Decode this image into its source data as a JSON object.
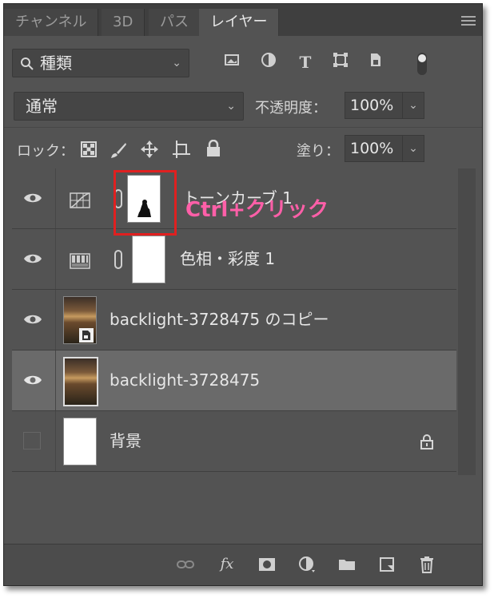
{
  "tabs": [
    {
      "label": "チャンネル",
      "active": false
    },
    {
      "label": "3D",
      "active": false
    },
    {
      "label": "パス",
      "active": false
    },
    {
      "label": "レイヤー",
      "active": true
    }
  ],
  "filter": {
    "kind_label": "種類"
  },
  "blend": {
    "mode": "通常",
    "opacity_label": "不透明度：",
    "opacity_value": "100%"
  },
  "lock": {
    "label": "ロック：",
    "fill_label": "塗り：",
    "fill_value": "100%"
  },
  "layers": [
    {
      "name": "トーンカーブ 1",
      "type": "curves-adjustment",
      "visible": true,
      "selected": false
    },
    {
      "name": "色相・彩度 1",
      "type": "hue-saturation-adjustment",
      "visible": true,
      "selected": false
    },
    {
      "name": "backlight-3728475 のコピー",
      "type": "smart-object",
      "visible": true,
      "selected": false
    },
    {
      "name": "backlight-3728475",
      "type": "image",
      "visible": true,
      "selected": true
    },
    {
      "name": "背景",
      "type": "background",
      "visible": false,
      "selected": false,
      "locked": true
    }
  ],
  "annotation": {
    "text": "Ctrl+クリック",
    "color": "#ff5fa8",
    "box_color": "#e02020"
  },
  "colors": {
    "panel": "#535353",
    "selected_row": "#6a6a6a",
    "tabbar": "#3f3f3f"
  },
  "icons": [
    "image-filter-icon",
    "adjustment-filter-icon",
    "type-filter-icon",
    "shape-filter-icon",
    "smart-object-filter-icon",
    "filter-toggle-icon",
    "lock-transparent-icon",
    "lock-paint-icon",
    "lock-move-icon",
    "lock-artboard-icon",
    "lock-all-icon",
    "link-layers-icon",
    "fx-icon",
    "add-mask-icon",
    "new-adjustment-icon",
    "new-group-icon",
    "new-layer-icon",
    "delete-icon"
  ]
}
